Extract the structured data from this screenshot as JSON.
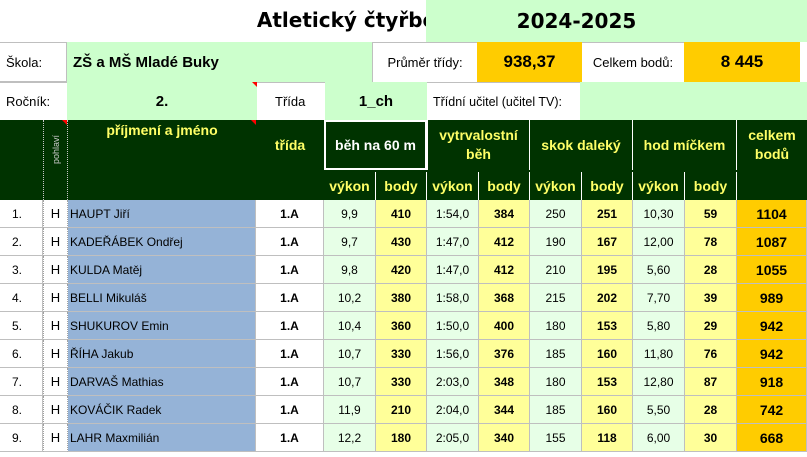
{
  "header": {
    "title": "Atletický čtyřboj",
    "year": "2024-2025",
    "school_label": "Škola:",
    "school_value": "ZŠ a MŠ Mladé Buky",
    "avg_label": "Průměr třídy:",
    "avg_value": "938,37",
    "total_label": "Celkem bodů:",
    "total_value": "8 445",
    "grade_label": "Ročník:",
    "grade_value": "2.",
    "class_label": "Třída",
    "class_value": "1_ch",
    "teacher_label": "Třídní učitel (učitel TV):",
    "teacher_value": ""
  },
  "table_header": {
    "gender": "pohlaví",
    "name": "příjmení a jméno",
    "class": "třída",
    "run60": "běh na 60 m",
    "endurance_line1": "vytrvalostní",
    "endurance_line2": "běh",
    "longjump": "skok daleký",
    "throw": "hod míčkem",
    "total_line1": "celkem",
    "total_line2": "bodů",
    "performance": "výkon",
    "points": "body"
  },
  "rows": [
    {
      "no": "1.",
      "g": "H",
      "name": "HAUPT Jiří",
      "cls": "1.A",
      "r60": "9,9",
      "p60": "410",
      "end": "1:54,0",
      "pend": "384",
      "lj": "250",
      "plj": "251",
      "thr": "10,30",
      "pthr": "59",
      "total": "1104"
    },
    {
      "no": "2.",
      "g": "H",
      "name": "KADEŘÁBEK Ondřej",
      "cls": "1.A",
      "r60": "9,7",
      "p60": "430",
      "end": "1:47,0",
      "pend": "412",
      "lj": "190",
      "plj": "167",
      "thr": "12,00",
      "pthr": "78",
      "total": "1087"
    },
    {
      "no": "3.",
      "g": "H",
      "name": "KULDA Matěj",
      "cls": "1.A",
      "r60": "9,8",
      "p60": "420",
      "end": "1:47,0",
      "pend": "412",
      "lj": "210",
      "plj": "195",
      "thr": "5,60",
      "pthr": "28",
      "total": "1055"
    },
    {
      "no": "4.",
      "g": "H",
      "name": "BELLI Mikuláš",
      "cls": "1.A",
      "r60": "10,2",
      "p60": "380",
      "end": "1:58,0",
      "pend": "368",
      "lj": "215",
      "plj": "202",
      "thr": "7,70",
      "pthr": "39",
      "total": "989"
    },
    {
      "no": "5.",
      "g": "H",
      "name": "SHUKUROV Emin",
      "cls": "1.A",
      "r60": "10,4",
      "p60": "360",
      "end": "1:50,0",
      "pend": "400",
      "lj": "180",
      "plj": "153",
      "thr": "5,80",
      "pthr": "29",
      "total": "942"
    },
    {
      "no": "6.",
      "g": "H",
      "name": "ŘÍHA Jakub",
      "cls": "1.A",
      "r60": "10,7",
      "p60": "330",
      "end": "1:56,0",
      "pend": "376",
      "lj": "185",
      "plj": "160",
      "thr": "11,80",
      "pthr": "76",
      "total": "942"
    },
    {
      "no": "7.",
      "g": "H",
      "name": "DARVAŠ Mathias",
      "cls": "1.A",
      "r60": "10,7",
      "p60": "330",
      "end": "2:03,0",
      "pend": "348",
      "lj": "180",
      "plj": "153",
      "thr": "12,80",
      "pthr": "87",
      "total": "918"
    },
    {
      "no": "8.",
      "g": "H",
      "name": "KOVÁČIK Radek",
      "cls": "1.A",
      "r60": "11,9",
      "p60": "210",
      "end": "2:04,0",
      "pend": "344",
      "lj": "185",
      "plj": "160",
      "thr": "5,50",
      "pthr": "28",
      "total": "742"
    },
    {
      "no": "9.",
      "g": "H",
      "name": "LAHR Maxmilián",
      "cls": "1.A",
      "r60": "12,2",
      "p60": "180",
      "end": "2:05,0",
      "pend": "340",
      "lj": "155",
      "plj": "118",
      "thr": "6,00",
      "pthr": "30",
      "total": "668"
    }
  ]
}
